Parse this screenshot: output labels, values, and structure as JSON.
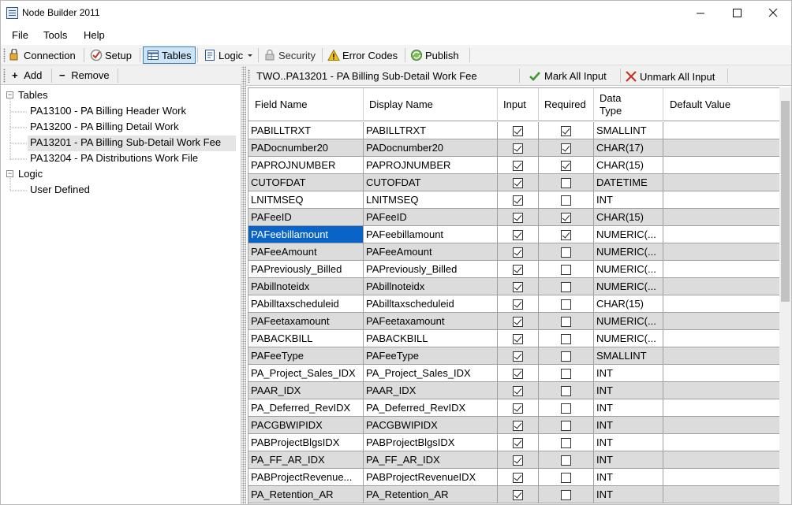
{
  "window": {
    "title": "Node Builder 2011",
    "minimize": "—",
    "maximize": "☐",
    "close": "✕"
  },
  "menu": {
    "items": [
      "File",
      "Tools",
      "Help"
    ]
  },
  "toolbar": {
    "connection": "Connection",
    "setup": "Setup",
    "tables": "Tables",
    "logic": "Logic",
    "security": "Security",
    "error_codes": "Error Codes",
    "publish": "Publish"
  },
  "left_toolbar": {
    "add": "Add",
    "remove": "Remove",
    "add_glyph": "+",
    "remove_glyph": "−"
  },
  "tree": {
    "tables_label": "Tables",
    "tables": [
      "PA13100  -  PA Billing Header Work",
      "PA13200  -  PA Billing Detail Work",
      "PA13201  -  PA Billing Sub-Detail Work Fee",
      "PA13204  -  PA Distributions Work File"
    ],
    "logic_label": "Logic",
    "logic": [
      "User Defined"
    ],
    "toggle": "−"
  },
  "right_toolbar": {
    "title": "TWO..PA13201  -  PA Billing Sub-Detail Work Fee",
    "mark_all": "Mark All Input",
    "unmark_all": "Unmark All Input"
  },
  "grid": {
    "columns": [
      "Field Name",
      "Display Name",
      "Input",
      "Required",
      "Data Type",
      "Default Value"
    ],
    "rows": [
      {
        "field": "PABILLTRXT",
        "display": "PABILLTRXT",
        "input": true,
        "required": true,
        "type": "SMALLINT"
      },
      {
        "field": "PADocnumber20",
        "display": "PADocnumber20",
        "input": true,
        "required": true,
        "type": "CHAR(17)"
      },
      {
        "field": "PAPROJNUMBER",
        "display": "PAPROJNUMBER",
        "input": true,
        "required": true,
        "type": "CHAR(15)"
      },
      {
        "field": "CUTOFDAT",
        "display": "CUTOFDAT",
        "input": true,
        "required": false,
        "type": "DATETIME"
      },
      {
        "field": "LNITMSEQ",
        "display": "LNITMSEQ",
        "input": true,
        "required": false,
        "type": "INT"
      },
      {
        "field": "PAFeeID",
        "display": "PAFeeID",
        "input": true,
        "required": true,
        "type": "CHAR(15)"
      },
      {
        "field": "PAFeebillamount",
        "display": "PAFeebillamount",
        "input": true,
        "required": true,
        "type": "NUMERIC(..."
      },
      {
        "field": "PAFeeAmount",
        "display": "PAFeeAmount",
        "input": true,
        "required": false,
        "type": "NUMERIC(..."
      },
      {
        "field": "PAPreviously_Billed",
        "display": "PAPreviously_Billed",
        "input": true,
        "required": false,
        "type": "NUMERIC(..."
      },
      {
        "field": "PAbillnoteidx",
        "display": "PAbillnoteidx",
        "input": true,
        "required": false,
        "type": "NUMERIC(..."
      },
      {
        "field": "PAbilltaxscheduleid",
        "display": "PAbilltaxscheduleid",
        "input": true,
        "required": false,
        "type": "CHAR(15)"
      },
      {
        "field": "PAFeetaxamount",
        "display": "PAFeetaxamount",
        "input": true,
        "required": false,
        "type": "NUMERIC(..."
      },
      {
        "field": "PABACKBILL",
        "display": "PABACKBILL",
        "input": true,
        "required": false,
        "type": "NUMERIC(..."
      },
      {
        "field": "PAFeeType",
        "display": "PAFeeType",
        "input": true,
        "required": false,
        "type": "SMALLINT"
      },
      {
        "field": "PA_Project_Sales_IDX",
        "display": "PA_Project_Sales_IDX",
        "input": true,
        "required": false,
        "type": "INT"
      },
      {
        "field": "PAAR_IDX",
        "display": "PAAR_IDX",
        "input": true,
        "required": false,
        "type": "INT"
      },
      {
        "field": "PA_Deferred_RevIDX",
        "display": "PA_Deferred_RevIDX",
        "input": true,
        "required": false,
        "type": "INT"
      },
      {
        "field": "PACGBWIPIDX",
        "display": "PACGBWIPIDX",
        "input": true,
        "required": false,
        "type": "INT"
      },
      {
        "field": "PABProjectBlgsIDX",
        "display": "PABProjectBlgsIDX",
        "input": true,
        "required": false,
        "type": "INT"
      },
      {
        "field": "PA_FF_AR_IDX",
        "display": "PA_FF_AR_IDX",
        "input": true,
        "required": false,
        "type": "INT"
      },
      {
        "field": "PABProjectRevenue...",
        "display": "PABProjectRevenueIDX",
        "input": true,
        "required": false,
        "type": "INT"
      },
      {
        "field": "PA_Retention_AR",
        "display": "PA_Retention_AR",
        "input": true,
        "required": false,
        "type": "INT"
      }
    ]
  },
  "colors": {
    "selection": "#0a64c8",
    "alt_row": "#dcdcdc",
    "active_tab_bg": "#cce4f7",
    "active_tab_border": "#3c7fb1"
  }
}
